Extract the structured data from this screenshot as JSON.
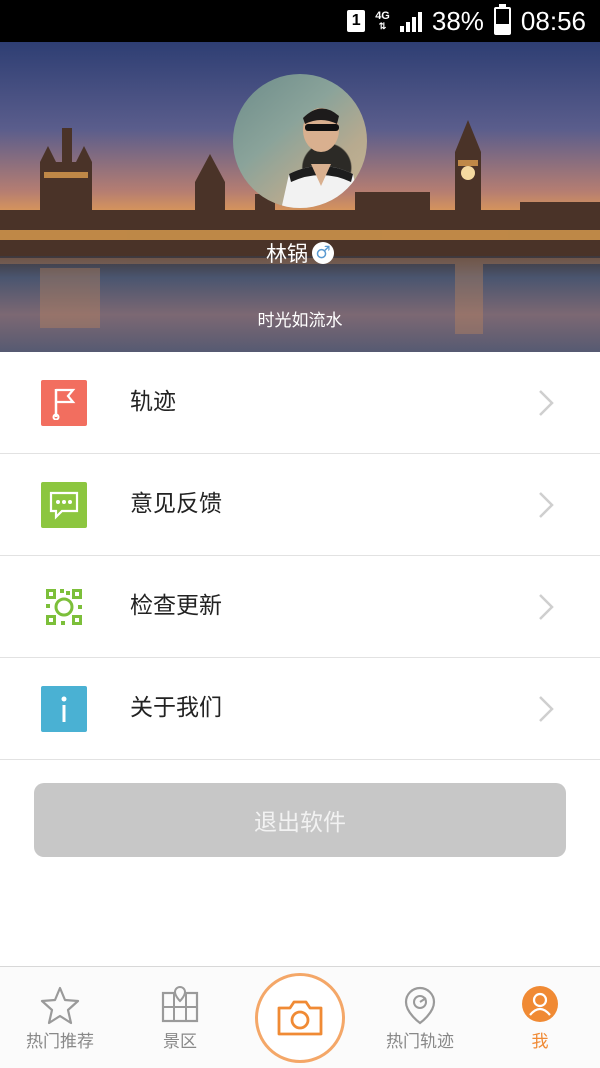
{
  "status_bar": {
    "sim_slot": "1",
    "network": "4G",
    "battery_percent_text": "38%",
    "battery_level": 0.38,
    "time": "08:56"
  },
  "profile": {
    "username": "林锅",
    "gender_symbol": "♂",
    "signature": "时光如流水"
  },
  "menu": {
    "items": [
      {
        "label": "轨迹",
        "icon": "flag-icon",
        "icon_color": "#f26e5f"
      },
      {
        "label": "意见反馈",
        "icon": "feedback-chat-icon",
        "icon_color": "#8cc63f"
      },
      {
        "label": "检查更新",
        "icon": "qr-scan-icon",
        "icon_color": "#7cbf3a"
      },
      {
        "label": "关于我们",
        "icon": "info-icon",
        "icon_color": "#4ab1d3"
      }
    ]
  },
  "logout": {
    "label": "退出软件"
  },
  "bottom_nav": {
    "tabs": [
      {
        "label": "热门推荐",
        "icon": "star-icon"
      },
      {
        "label": "景区",
        "icon": "map-icon"
      },
      {
        "label": "",
        "icon": "camera-icon"
      },
      {
        "label": "热门轨迹",
        "icon": "location-pin-icon"
      },
      {
        "label": "我",
        "icon": "user-icon",
        "active": true
      }
    ],
    "accent_color": "#f08a34"
  }
}
